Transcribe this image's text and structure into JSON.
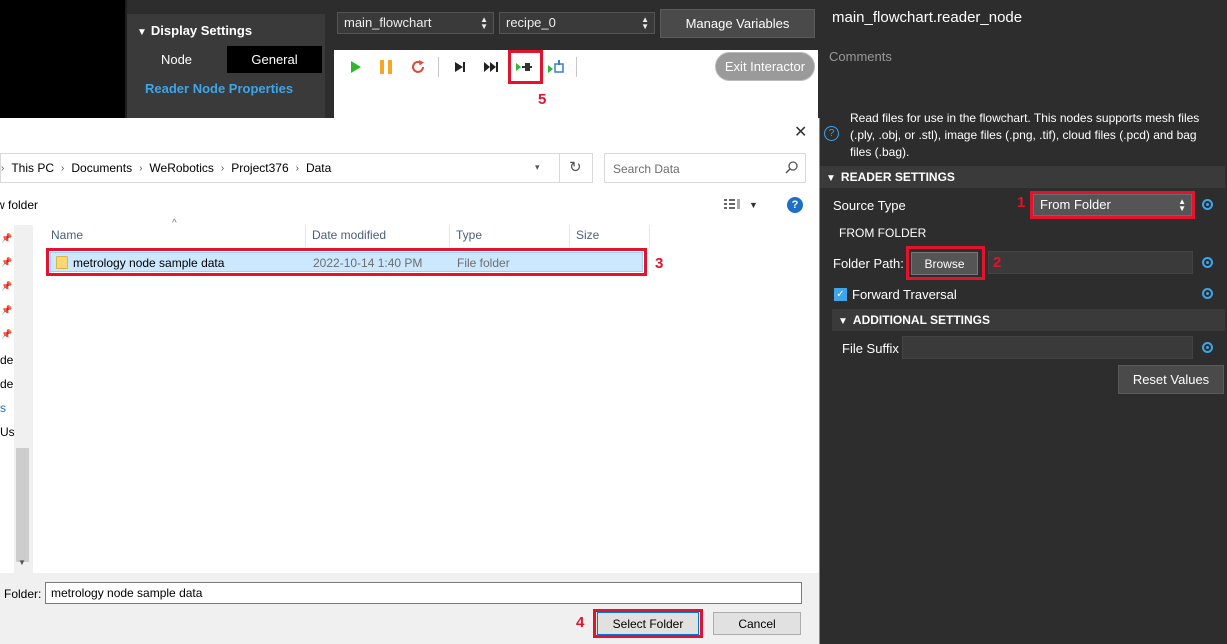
{
  "display_settings": {
    "title": "Display Settings",
    "tabs": [
      "Node",
      "General"
    ],
    "active_tab": "General",
    "link": "Reader Node Properties"
  },
  "toolbar": {
    "flowchart_combo": "main_flowchart",
    "recipe_combo": "recipe_0",
    "manage_variables": "Manage Variables",
    "exit_interactor": "Exit Interactor",
    "icons": [
      "play-icon",
      "pause-icon",
      "reset-icon",
      "step-icon",
      "step-over-icon",
      "step-into-node-icon",
      "step-out-node-icon"
    ],
    "colors": {
      "play": "#2eb82e",
      "pause": "#f5a623",
      "reset": "#e04a3a"
    }
  },
  "properties": {
    "node_title": "main_flowchart.reader_node",
    "comments_label": "Comments",
    "description": "Read files for use in the flowchart. This nodes supports mesh files (.ply, .obj, or .stl), image files (.png, .tif), cloud files (.pcd) and bag files (.bag).",
    "help_glyph": "?",
    "reader_settings": {
      "header": "READER SETTINGS",
      "source_type_label": "Source Type",
      "source_type_value": "From Folder",
      "from_folder_label": "FROM FOLDER",
      "folder_path_label": "Folder Path:",
      "browse_label": "Browse",
      "forward_traversal_label": "Forward Traversal",
      "forward_traversal_checked": true
    },
    "additional_settings": {
      "header": "ADDITIONAL SETTINGS",
      "file_suffix_label": "File Suffix"
    },
    "reset_values": "Reset Values"
  },
  "dialog": {
    "close_glyph": "✕",
    "breadcrumbs": [
      "This PC",
      "Documents",
      "WeRobotics",
      "Project376",
      "Data"
    ],
    "search_placeholder": "Search Data",
    "new_folder": "w folder",
    "columns": [
      "Name",
      "Date modified",
      "Type",
      "Size"
    ],
    "rows": [
      {
        "name": "metrology node sample data",
        "date_modified": "2022-10-14 1:40 PM",
        "type": "File folder",
        "size": ""
      }
    ],
    "nav_fragments": [
      "de",
      "de",
      "s",
      "Us"
    ],
    "folder_label": "Folder:",
    "folder_value": "metrology node sample data",
    "select_folder": "Select Folder",
    "cancel": "Cancel"
  },
  "annotations": {
    "accent_color": "#e3122d",
    "labels": [
      "1",
      "2",
      "3",
      "4",
      "5"
    ]
  }
}
